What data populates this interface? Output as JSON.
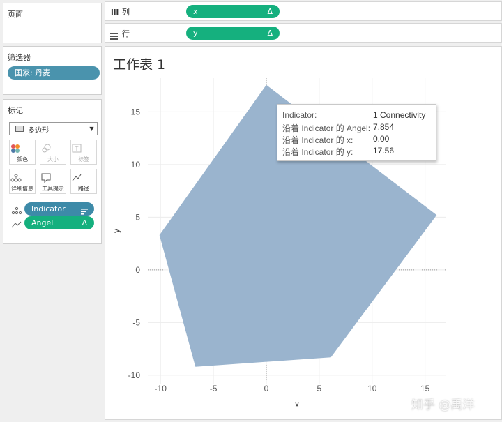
{
  "pages": {
    "title": "页面"
  },
  "shelves": {
    "columns": {
      "label": "列",
      "pill": "x",
      "pill_icon": "Δ"
    },
    "rows": {
      "label": "行",
      "pill": "y",
      "pill_icon": "Δ"
    }
  },
  "filters": {
    "title": "筛选器",
    "items": [
      "国家: 丹麦"
    ]
  },
  "marks": {
    "title": "标记",
    "mark_type": "多边形",
    "buttons": [
      "颜色",
      "大小",
      "标签",
      "详细信息",
      "工具提示",
      "路径"
    ],
    "fields": [
      {
        "label": "Indicator",
        "type": "detail"
      },
      {
        "label": "Angel",
        "type": "path",
        "icon": "Δ"
      }
    ]
  },
  "worksheet": {
    "title": "工作表 1"
  },
  "tooltip": {
    "rows": [
      {
        "k": "Indicator:",
        "v": "1 Connectivity"
      },
      {
        "k": "沿着 Indicator 的 Angel:",
        "v": "7.854"
      },
      {
        "k": "沿着 Indicator 的 x:",
        "v": "0.00"
      },
      {
        "k": "沿着 Indicator 的 y:",
        "v": "17.56"
      }
    ]
  },
  "watermark": "知乎 @禹洋",
  "colors": {
    "polygon": "#9ab4ce",
    "green_pill": "#15b07e",
    "blue_pill": "#3d8aa8"
  },
  "chart_data": {
    "type": "area",
    "mark": "polygon",
    "xlabel": "x",
    "ylabel": "y",
    "xlim": [
      -11.2,
      17.0
    ],
    "ylim": [
      -10.8,
      18.2
    ],
    "xticks": [
      -10,
      -5,
      0,
      5,
      10,
      15
    ],
    "yticks": [
      -10,
      -5,
      0,
      5,
      10,
      15
    ],
    "grid": true,
    "polygon": {
      "x": [
        0.0,
        16.1,
        6.1,
        -6.7,
        -10.1
      ],
      "y": [
        17.56,
        5.2,
        -8.3,
        -9.2,
        3.3
      ]
    }
  }
}
